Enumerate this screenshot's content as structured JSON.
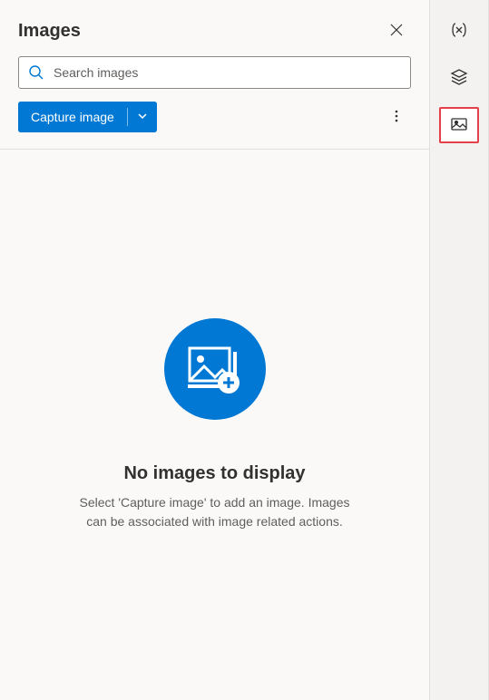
{
  "panel": {
    "title": "Images"
  },
  "search": {
    "placeholder": "Search images"
  },
  "actions": {
    "capture_label": "Capture image"
  },
  "empty_state": {
    "title": "No images to display",
    "description": "Select 'Capture image' to add an image. Images can be associated with image related actions."
  },
  "rail": {
    "items": [
      {
        "name": "variables",
        "selected": false
      },
      {
        "name": "ui-elements",
        "selected": false
      },
      {
        "name": "images",
        "selected": true
      }
    ]
  }
}
